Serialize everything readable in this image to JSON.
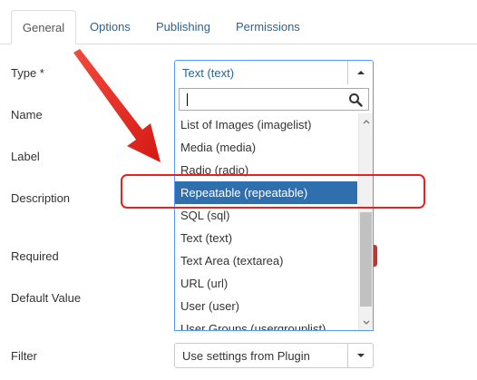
{
  "tabs": [
    {
      "label": "General",
      "active": true
    },
    {
      "label": "Options",
      "active": false
    },
    {
      "label": "Publishing",
      "active": false
    },
    {
      "label": "Permissions",
      "active": false
    }
  ],
  "fields": {
    "type_label": "Type *",
    "name_label": "Name",
    "label_label": "Label",
    "description_label": "Description",
    "required_label": "Required",
    "default_value_label": "Default Value",
    "filter_label": "Filter"
  },
  "type_select": {
    "value": "Text (text)",
    "search_value": "",
    "options": [
      "List of Images (imagelist)",
      "Media (media)",
      "Radio (radio)",
      "Repeatable (repeatable)",
      "SQL (sql)",
      "Text (text)",
      "Text Area (textarea)",
      "URL (url)",
      "User (user)",
      "User Groups (usergrouplist)"
    ],
    "highlighted_option": "Repeatable (repeatable)"
  },
  "filter_select": {
    "value": "Use settings from Plugin"
  },
  "colors": {
    "link": "#2a6496",
    "highlight": "#2f6fad",
    "annotation_red": "#e8211d"
  },
  "icons": {
    "search": "search-icon",
    "arrow": "annotation-arrow"
  }
}
